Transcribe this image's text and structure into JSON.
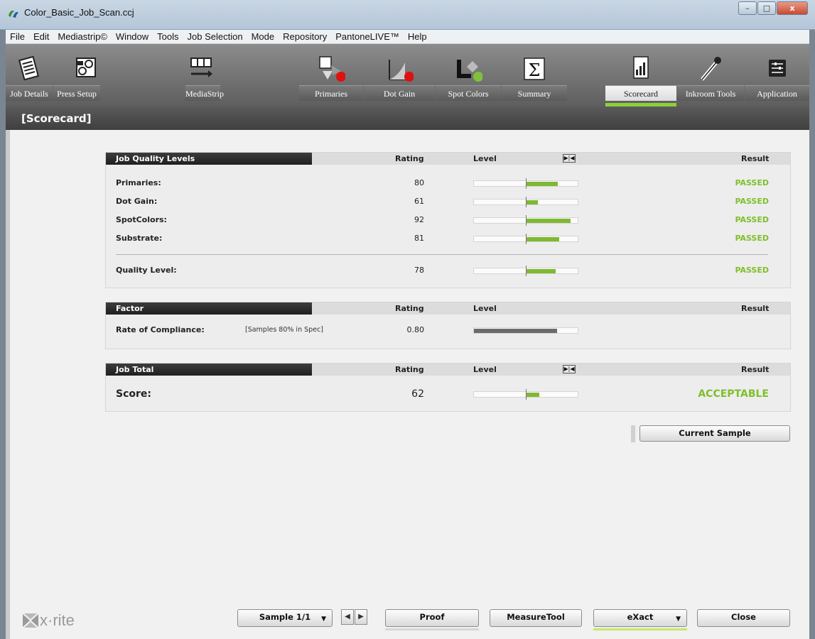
{
  "window": {
    "title": "Color_Basic_Job_Scan.ccj",
    "min": "–",
    "max": "□",
    "close": "x"
  },
  "menu": [
    "File",
    "Edit",
    "Mediastrip©",
    "Window",
    "Tools",
    "Job Selection",
    "Mode",
    "Repository",
    "PantoneLIVE™",
    "Help"
  ],
  "toolbar": {
    "job_details": "Job Details",
    "press_setup": "Press Setup",
    "mediastrip": "MediaStrip",
    "primaries": "Primaries",
    "dot_gain": "Dot Gain",
    "spot_colors": "Spot Colors",
    "summary": "Summary",
    "scorecard": "Scorecard",
    "inkroom_tools": "Inkroom Tools",
    "application": "Application",
    "active": "Scorecard"
  },
  "section_title": "[Scorecard]",
  "quality": {
    "header": "Job Quality Levels",
    "col_rating": "Rating",
    "col_level": "Level",
    "col_result": "Result",
    "toggle": "▶|◀",
    "rows": [
      {
        "name": "Primaries:",
        "rating": "80",
        "level": 0.3,
        "result": "PASSED"
      },
      {
        "name": "Dot Gain:",
        "rating": "61",
        "level": 0.11,
        "result": "PASSED"
      },
      {
        "name": "SpotColors:",
        "rating": "92",
        "level": 0.42,
        "result": "PASSED"
      },
      {
        "name": "Substrate:",
        "rating": "81",
        "level": 0.31,
        "result": "PASSED"
      }
    ],
    "overall": {
      "name": "Quality Level:",
      "rating": "78",
      "level": 0.28,
      "result": "PASSED"
    }
  },
  "factor": {
    "header": "Factor",
    "col_rating": "Rating",
    "col_level": "Level",
    "col_result": "Result",
    "row": {
      "name": "Rate of Compliance:",
      "note": "[Samples 80% in Spec]",
      "rating": "0.80",
      "level": 0.8
    }
  },
  "total": {
    "header": "Job Total",
    "col_rating": "Rating",
    "col_level": "Level",
    "col_result": "Result",
    "toggle": "▶|◀",
    "row": {
      "name": "Score:",
      "rating": "62",
      "level": 0.12,
      "result": "ACCEPTABLE"
    }
  },
  "current_sample": "Current Sample",
  "bottom": {
    "logo": "x·rite",
    "sample": "Sample 1/1",
    "prev": "◀",
    "next": "▶",
    "proof": "Proof",
    "measure_tool": "MeasureTool",
    "exact": "eXact",
    "close": "Close"
  },
  "colors": {
    "accent_green": "#8dd03a",
    "passed": "#7fbf2b",
    "bar": "#7fb833"
  }
}
